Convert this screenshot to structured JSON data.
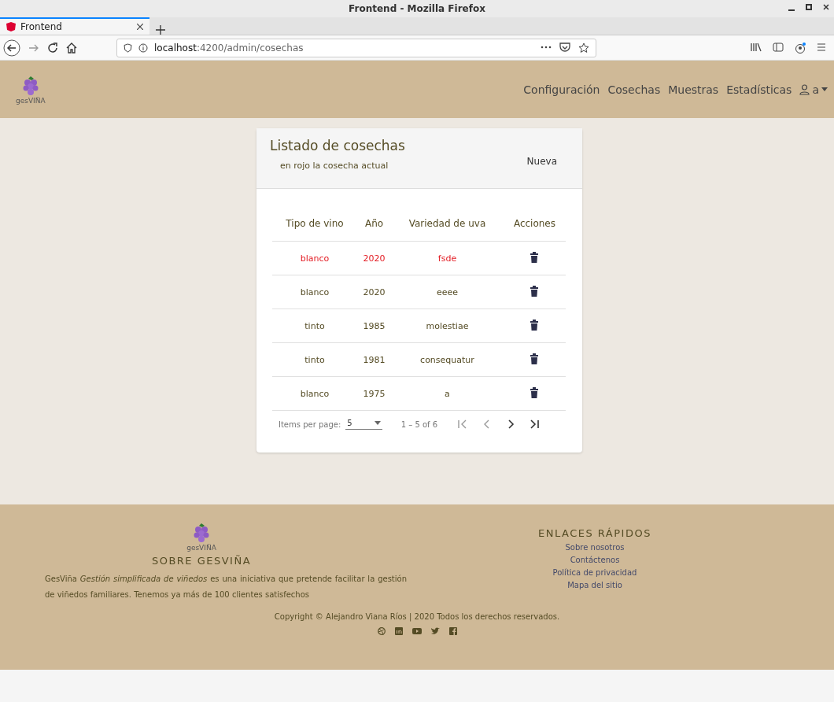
{
  "window": {
    "title": "Frontend - Mozilla Firefox"
  },
  "tabs": [
    {
      "label": "Frontend",
      "selected": true
    }
  ],
  "address_bar": {
    "host": "localhost",
    "path": ":4200/admin/cosechas"
  },
  "navbar": {
    "logo_text": "gesVIÑA",
    "links": [
      "Configuración",
      "Cosechas",
      "Muestras",
      "Estadísticas"
    ],
    "user": "a"
  },
  "card": {
    "title": "Listado de cosechas",
    "subtitle": "en rojo la cosecha actual",
    "action": "Nueva",
    "table": {
      "columns": [
        "Tipo de vino",
        "Año",
        "Variedad de uva",
        "Acciones"
      ],
      "rows": [
        {
          "cells": [
            "blanco",
            "2020",
            "fsde"
          ],
          "current": true
        },
        {
          "cells": [
            "blanco",
            "2020",
            "eeee"
          ],
          "current": false
        },
        {
          "cells": [
            "tinto",
            "1985",
            "molestiae"
          ],
          "current": false
        },
        {
          "cells": [
            "tinto",
            "1981",
            "consequatur"
          ],
          "current": false
        },
        {
          "cells": [
            "blanco",
            "1975",
            "a"
          ],
          "current": false
        }
      ]
    },
    "paginator": {
      "label": "Items per page:",
      "page_size": "5",
      "range": "1 – 5 of 6"
    }
  },
  "footer": {
    "logo_text": "gesVIÑA",
    "about_title": "SOBRE GESVIÑA",
    "about_text": "GesViña *Gestión simplificada de viñedos* es una iniciativa que pretende facilitar la gestión de viñedos familiares. Tenemos ya más de 100 clientes satisfechos",
    "links_title": "ENLACES RÁPIDOS",
    "links": [
      "Sobre nosotros",
      "Contáctenos",
      "Política de privacidad",
      "Mapa del sitio"
    ],
    "copyright": "Copyright © Alejandro Viana Ríos | 2020 Todos los derechos reservados."
  }
}
